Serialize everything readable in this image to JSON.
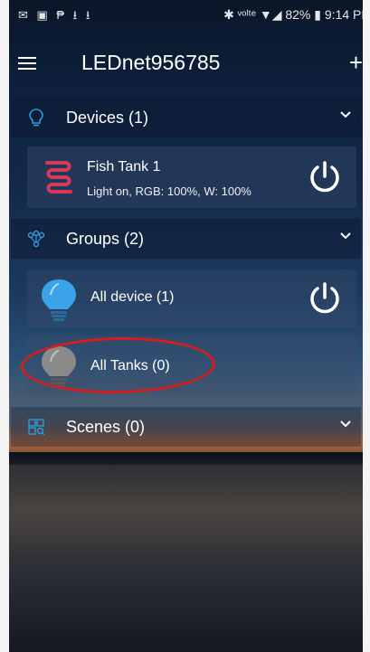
{
  "status_bar": {
    "left_icons": "✉ ▣ ₱ ⭳ ⭳",
    "right_text": "✱ ᵛᵒˡᵗᵉ ▼◢ 82% ▮ 9:14 PM"
  },
  "toolbar": {
    "title": "LEDnet956785",
    "add_label": "+"
  },
  "sections": {
    "devices": {
      "title": "Devices (1)"
    },
    "groups": {
      "title": "Groups (2)"
    },
    "scenes": {
      "title": "Scenes (0)"
    }
  },
  "devices": [
    {
      "name": "Fish Tank 1",
      "status": "Light on, RGB: 100%, W: 100%",
      "icon": "led-strip-icon"
    }
  ],
  "groups": [
    {
      "name": "All device (1)",
      "icon": "bulb-blue-icon",
      "state": "on"
    },
    {
      "name": "All Tanks (0)",
      "icon": "bulb-gray-icon",
      "state": "empty"
    }
  ],
  "colors": {
    "accent_blue": "#2f9bdf",
    "bulb_blue": "#3aa2e6",
    "bulb_gray": "#8a8a8a",
    "highlight_red": "#d41e1e",
    "strip_red": "#d6375a"
  }
}
